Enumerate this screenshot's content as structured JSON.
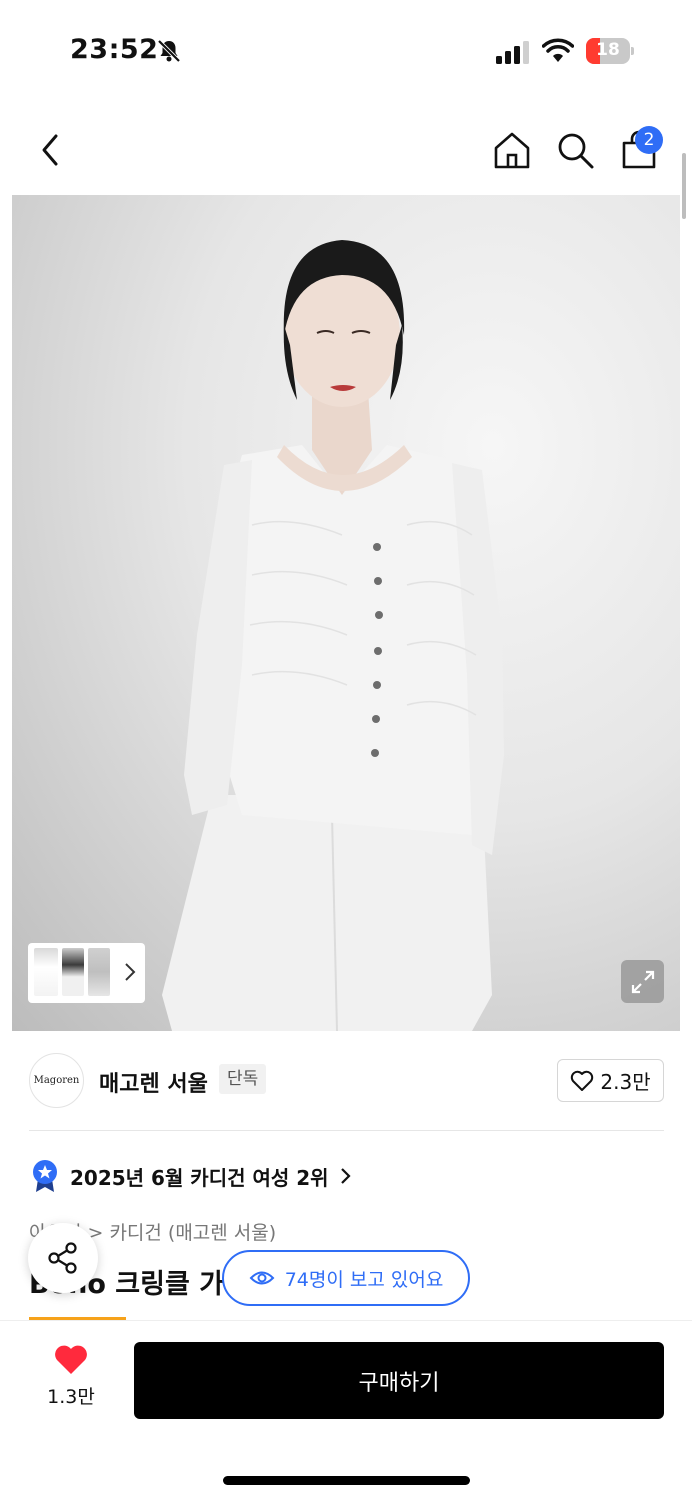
{
  "status_bar": {
    "time": "23:52",
    "battery": "18"
  },
  "header": {
    "cart_badge": "2"
  },
  "icons": {
    "back": "chevron-left-icon",
    "home": "home-icon",
    "search": "search-icon",
    "cart": "bag-icon",
    "expand": "expand-icon",
    "share": "share-icon",
    "eye": "eye-icon",
    "heart": "heart-icon",
    "medal": "medal-icon"
  },
  "brand": {
    "logo_text": "Magoren",
    "name": "매고렌 서울",
    "tag": "단독",
    "likes": "2.3만"
  },
  "ranking": {
    "text": "2025년 6월 카디건 여성 2위"
  },
  "breadcrumb": "아우터 > 카디건 (매고렌 서울)",
  "product": {
    "title": "Boho 크링클 가디건"
  },
  "viewers": {
    "text": "74명이 보고 있어요"
  },
  "bottom": {
    "wish_count": "1.3만",
    "buy_label": "구매하기"
  },
  "colors": {
    "accent": "#2f6df6",
    "heart": "#ff2a3d",
    "ranking_bar": "#f6a21a"
  }
}
